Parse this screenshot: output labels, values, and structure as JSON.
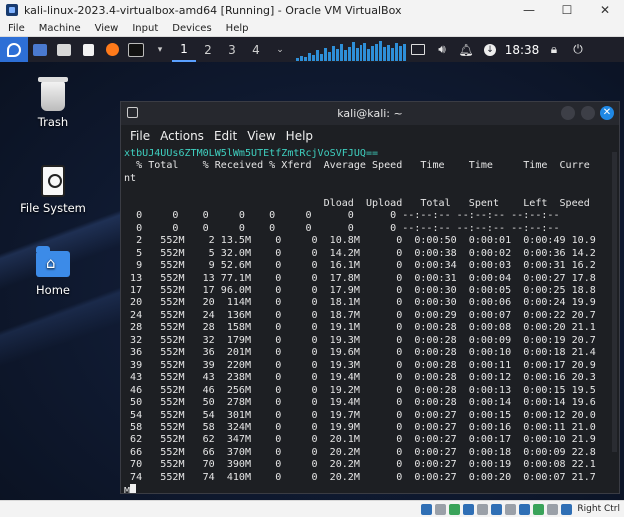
{
  "host": {
    "window_title": "kali-linux-2023.4-virtualbox-amd64 [Running] - Oracle VM VirtualBox",
    "controls": {
      "minimize": "—",
      "maximize": "☐",
      "close": "✕"
    },
    "menu": [
      "File",
      "Machine",
      "View",
      "Input",
      "Devices",
      "Help"
    ],
    "status_right": "Right Ctrl"
  },
  "panel": {
    "workspaces": [
      "1",
      "2",
      "3",
      "4"
    ],
    "active_workspace": "1",
    "clock": "18:38",
    "graph_levels": [
      3,
      5,
      4,
      8,
      6,
      10,
      7,
      12,
      9,
      14,
      11,
      16,
      10,
      13,
      18,
      12,
      15,
      17,
      11,
      14,
      16,
      19,
      13,
      15,
      12,
      17,
      14,
      16
    ]
  },
  "desktop": {
    "icons": [
      {
        "label": "Trash"
      },
      {
        "label": "File System"
      },
      {
        "label": "Home"
      }
    ]
  },
  "terminal": {
    "title": "kali@kali: ~",
    "menu": [
      "File",
      "Actions",
      "Edit",
      "View",
      "Help"
    ],
    "command_line": "xtbUJ4UUs6ZTM0LW5lWm5UTEtfZmtRcjVoSVFJUQ==",
    "header_lines": [
      "  % Total    % Received % Xferd  Average Speed   Time    Time     Time  Curre",
      "nt",
      "                                 Dload  Upload   Total   Spent    Left  Speed"
    ],
    "rows": [
      "  0     0    0     0    0     0      0      0 --:--:-- --:--:-- --:--:--",
      "  0     0    0     0    0     0      0      0 --:--:-- --:--:-- --:--:--",
      "  2   552M    2 13.5M    0     0  10.8M      0  0:00:50  0:00:01  0:00:49 10.9",
      "  5   552M    5 32.0M    0     0  14.2M      0  0:00:38  0:00:02  0:00:36 14.2",
      "  9   552M    9 52.6M    0     0  16.1M      0  0:00:34  0:00:03  0:00:31 16.2",
      " 13   552M   13 77.1M    0     0  17.8M      0  0:00:31  0:00:04  0:00:27 17.8",
      " 17   552M   17 96.0M    0     0  17.9M      0  0:00:30  0:00:05  0:00:25 18.8",
      " 20   552M   20  114M    0     0  18.1M      0  0:00:30  0:00:06  0:00:24 19.9",
      " 24   552M   24  136M    0     0  18.7M      0  0:00:29  0:00:07  0:00:22 20.7",
      " 28   552M   28  158M    0     0  19.1M      0  0:00:28  0:00:08  0:00:20 21.1",
      " 32   552M   32  179M    0     0  19.3M      0  0:00:28  0:00:09  0:00:19 20.7",
      " 36   552M   36  201M    0     0  19.6M      0  0:00:28  0:00:10  0:00:18 21.4",
      " 39   552M   39  220M    0     0  19.3M      0  0:00:28  0:00:11  0:00:17 20.9",
      " 43   552M   43  238M    0     0  19.4M      0  0:00:28  0:00:12  0:00:16 20.3",
      " 46   552M   46  256M    0     0  19.2M      0  0:00:28  0:00:13  0:00:15 19.5",
      " 50   552M   50  278M    0     0  19.4M      0  0:00:28  0:00:14  0:00:14 19.6",
      " 54   552M   54  301M    0     0  19.7M      0  0:00:27  0:00:15  0:00:12 20.0",
      " 58   552M   58  324M    0     0  19.9M      0  0:00:27  0:00:16  0:00:11 21.0",
      " 62   552M   62  347M    0     0  20.1M      0  0:00:27  0:00:17  0:00:10 21.9",
      " 66   552M   66  370M    0     0  20.2M      0  0:00:27  0:00:18  0:00:09 22.8",
      " 70   552M   70  390M    0     0  20.2M      0  0:00:27  0:00:19  0:00:08 22.1",
      " 74   552M   74  410M    0     0  20.2M      0  0:00:27  0:00:20  0:00:07 21.7"
    ],
    "prompt_fragment": "M"
  }
}
